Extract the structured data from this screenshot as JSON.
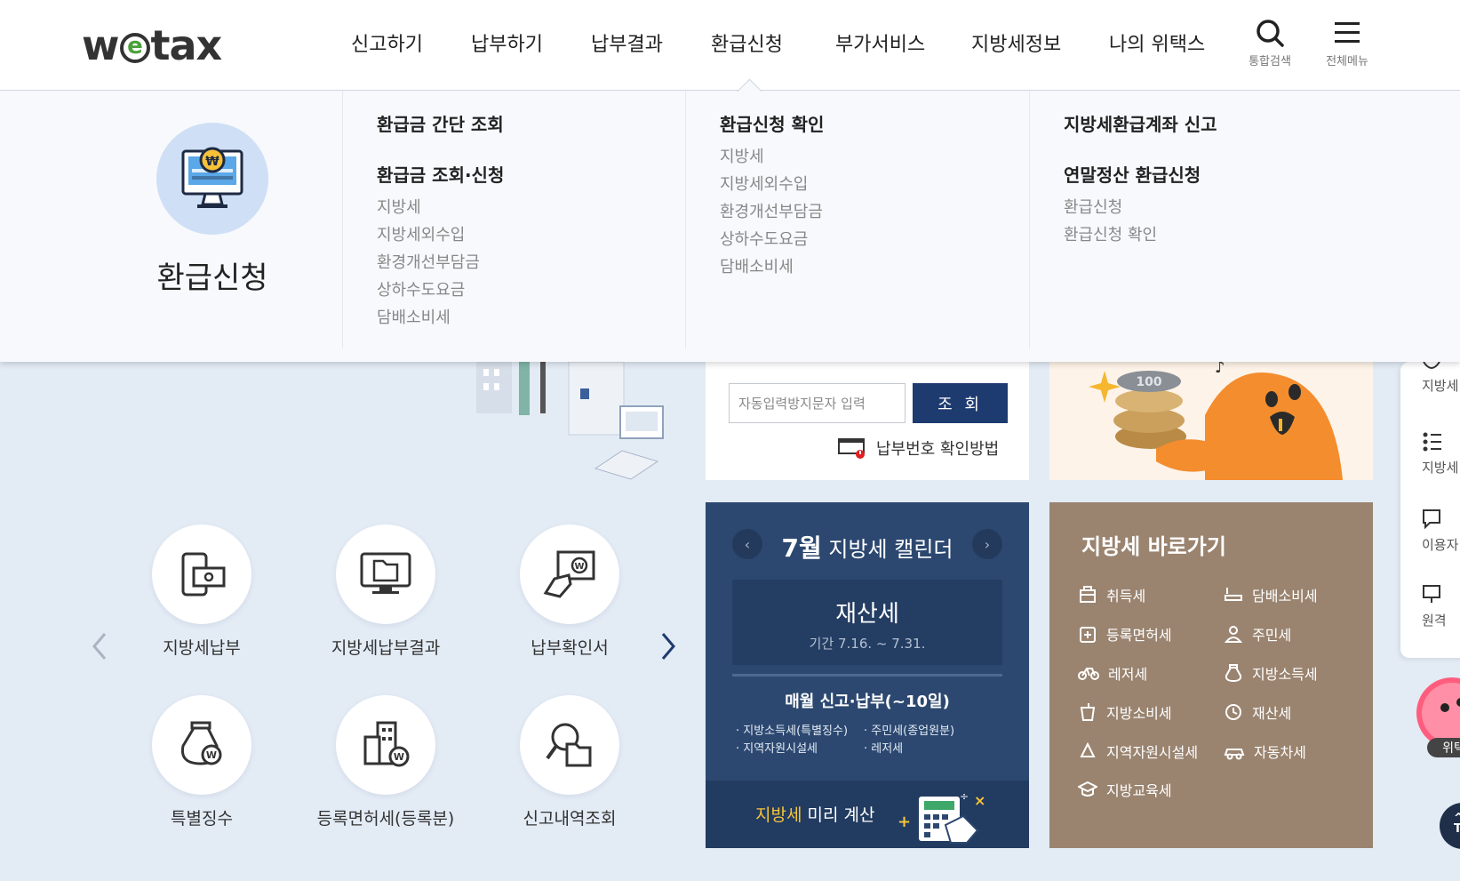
{
  "logo": {
    "pre": "w",
    "e": "e",
    "post": "tax"
  },
  "gnb": [
    {
      "label": "신고하기"
    },
    {
      "label": "납부하기"
    },
    {
      "label": "납부결과"
    },
    {
      "label": "환급신청"
    },
    {
      "label": "부가서비스"
    },
    {
      "label": "지방세정보"
    },
    {
      "label": "나의 위택스"
    }
  ],
  "header_icons": {
    "search_label": "통합검색",
    "menu_label": "전체메뉴"
  },
  "mega": {
    "title": "환급신청",
    "col1": {
      "heading1": "환급금 간단 조회",
      "heading2": "환급금 조회·신청",
      "items": [
        "지방세",
        "지방세외수입",
        "환경개선부담금",
        "상하수도요금",
        "담배소비세"
      ]
    },
    "col2": {
      "heading1": "환급신청 확인",
      "items": [
        "지방세",
        "지방세외수입",
        "환경개선부담금",
        "상하수도요금",
        "담배소비세"
      ]
    },
    "col3": {
      "heading1": "지방세환급계좌 신고",
      "heading2": "연말정산 환급신청",
      "items": [
        "환급신청",
        "환급신청 확인"
      ]
    }
  },
  "auth": {
    "placeholder": "자동입력방지문자 입력",
    "button": "조 회",
    "help": "납부번호 확인방법"
  },
  "quick_services": [
    {
      "label": "지방세납부"
    },
    {
      "label": "지방세납부결과"
    },
    {
      "label": "납부확인서"
    },
    {
      "label": "특별징수"
    },
    {
      "label": "등록면허세(등록분)"
    },
    {
      "label": "신고내역조회"
    }
  ],
  "calendar": {
    "month": "7월",
    "title_rest": "지방세 캘린더",
    "tax_name": "재산세",
    "period": "기간 7.16. ~ 7.31.",
    "monthly_title": "매월 신고·납부(~10일)",
    "monthly_items": [
      "· 지방소득세(특별징수)",
      "· 주민세(종업원분)",
      "· 지역자원시설세",
      "· 레저세"
    ],
    "calc_highlight": "지방세",
    "calc_rest": " 미리 계산"
  },
  "shortcut": {
    "title": "지방세 바로가기",
    "items": [
      {
        "label": "취득세",
        "icon": "building-icon"
      },
      {
        "label": "담배소비세",
        "icon": "cigarette-icon"
      },
      {
        "label": "등록면허세",
        "icon": "plus-doc-icon"
      },
      {
        "label": "주민세",
        "icon": "person-icon"
      },
      {
        "label": "레저세",
        "icon": "bicycle-icon"
      },
      {
        "label": "지방소득세",
        "icon": "money-bag-icon"
      },
      {
        "label": "지방소비세",
        "icon": "cup-icon"
      },
      {
        "label": "재산세",
        "icon": "clock-icon"
      },
      {
        "label": "지역자원시설세",
        "icon": "recycle-icon"
      },
      {
        "label": "자동차세",
        "icon": "car-icon"
      },
      {
        "label": "지방교육세",
        "icon": "graduation-cap-icon"
      }
    ]
  },
  "side_panel": [
    {
      "label": "지방세"
    },
    {
      "label": "지방세"
    },
    {
      "label": "이용자"
    },
    {
      "label": "원격"
    }
  ],
  "mascot_label": "위택",
  "top_button": "TO",
  "colors": {
    "navy": "#1e3b70",
    "calendar_bg": "#2c4870",
    "shortcut_bg": "#9a8470",
    "logo_green": "#4aa03a",
    "accent_yellow": "#f4c53a"
  }
}
